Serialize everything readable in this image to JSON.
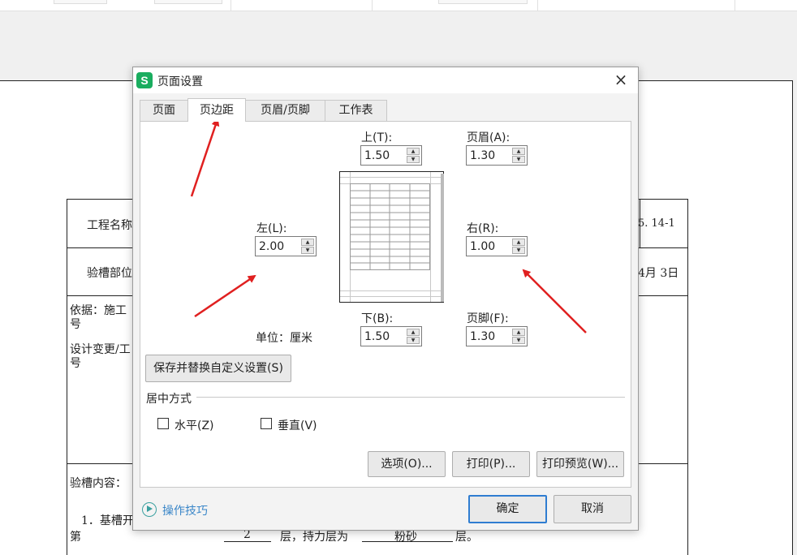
{
  "dialog": {
    "title": "页面设置",
    "app_logo_letter": "S",
    "close_glyph": "×",
    "tabs": [
      {
        "label": "页面",
        "active": false
      },
      {
        "label": "页边距",
        "active": true
      },
      {
        "label": "页眉/页脚",
        "active": false
      },
      {
        "label": "工作表",
        "active": false
      }
    ],
    "margins": {
      "top_label": "上(T):",
      "top_value": "1.50",
      "header_label": "页眉(A):",
      "header_value": "1.30",
      "left_label": "左(L):",
      "left_value": "2.00",
      "right_label": "右(R):",
      "right_value": "1.00",
      "bottom_label": "下(B):",
      "bottom_value": "1.50",
      "footer_label": "页脚(F):",
      "footer_value": "1.30",
      "unit_label": "单位：厘米"
    },
    "save_custom_button": "保存并替换自定义设置(S)",
    "center_group": {
      "title": "居中方式",
      "horizontal_label": "水平(Z)",
      "horizontal_checked": false,
      "vertical_label": "垂直(V)",
      "vertical_checked": false
    },
    "buttons": {
      "options": "选项(O)...",
      "print": "打印(P)...",
      "print_preview": "打印预览(W)...",
      "ok": "确定",
      "cancel": "取消"
    },
    "tips_link": "操作技巧"
  },
  "background_doc": {
    "project_name_fragment": "工程名称",
    "inspection_part_fragment": "验槽部位",
    "code_fragment": "5. 14-1",
    "date_fragment": "4月  3日",
    "basis_fragment": "依据：施工",
    "number_char_1": "号",
    "design_change_fragment": "设计变更/工",
    "number_char_2": "号",
    "content_fragment": "验槽内容：",
    "item1_fragment": "1．基槽开",
    "row_prefix": "第",
    "layer_number": "2",
    "layer_text": "层，持力层为",
    "soil_type": "粉砂",
    "layer_suffix": "层。"
  },
  "colors": {
    "annotation_arrow": "#e02020",
    "logo_green": "#1aad5f",
    "primary_border": "#2f7dd1",
    "link_blue": "#3a86c8"
  }
}
